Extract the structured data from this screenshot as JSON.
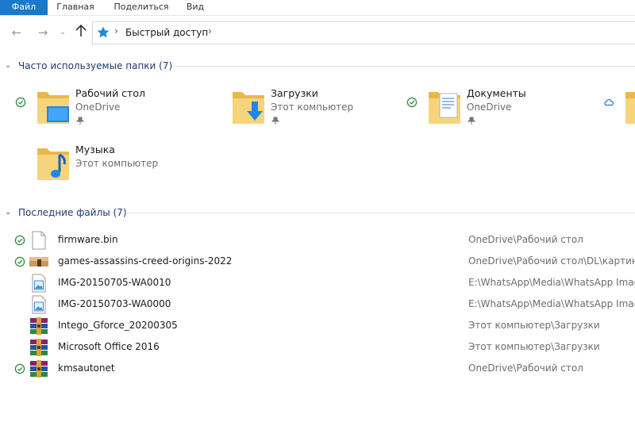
{
  "ribbon": {
    "tabs": [
      {
        "label": "Файл"
      },
      {
        "label": "Главная"
      },
      {
        "label": "Поделиться"
      },
      {
        "label": "Вид"
      }
    ]
  },
  "address": {
    "crumb": "Быстрый доступ",
    "icon": "quick-access-star-icon"
  },
  "frequent": {
    "header": "Часто используемые папки (7)",
    "items": [
      {
        "name": "Рабочий стол",
        "location": "OneDrive",
        "status": "synced",
        "icon": "desktop-folder-icon",
        "pinned": true
      },
      {
        "name": "Загрузки",
        "location": "Этот компьютер",
        "status": "none",
        "icon": "downloads-folder-icon",
        "pinned": true
      },
      {
        "name": "Документы",
        "location": "OneDrive",
        "status": "synced",
        "icon": "documents-folder-icon",
        "pinned": true
      },
      {
        "name": "",
        "location": "",
        "status": "cloud",
        "icon": "folder-icon",
        "pinned": false
      },
      {
        "name": "Музыка",
        "location": "Этот компьютер",
        "status": "none",
        "icon": "music-folder-icon",
        "pinned": false
      }
    ]
  },
  "recent": {
    "header": "Последние файлы (7)",
    "items": [
      {
        "name": "firmware.bin",
        "path": "OneDrive\\Рабочий стол",
        "status": "synced",
        "icon": "file-icon"
      },
      {
        "name": "games-assassins-creed-origins-2022",
        "path": "OneDrive\\Рабочий стол\\DL\\картинки",
        "status": "synced",
        "icon": "image-thumbnail-icon"
      },
      {
        "name": "IMG-20150705-WA0010",
        "path": "E:\\WhatsApp\\Media\\WhatsApp Images",
        "status": "none",
        "icon": "image-file-icon"
      },
      {
        "name": "IMG-20150703-WA0000",
        "path": "E:\\WhatsApp\\Media\\WhatsApp Images",
        "status": "none",
        "icon": "image-file-icon"
      },
      {
        "name": "Intego_Gforce_20200305",
        "path": "Этот компьютер\\Загрузки",
        "status": "none",
        "icon": "archive-icon"
      },
      {
        "name": "Microsoft Office 2016",
        "path": "Этот компьютер\\Загрузки",
        "status": "none",
        "icon": "archive-icon"
      },
      {
        "name": "kmsautonet",
        "path": "OneDrive\\Рабочий стол",
        "status": "synced",
        "icon": "archive-icon"
      }
    ]
  },
  "colors": {
    "accent": "#1979ca",
    "sync_green": "#2e8b3a",
    "folder": "#f4cf72",
    "header_text": "#1e3a6e"
  }
}
